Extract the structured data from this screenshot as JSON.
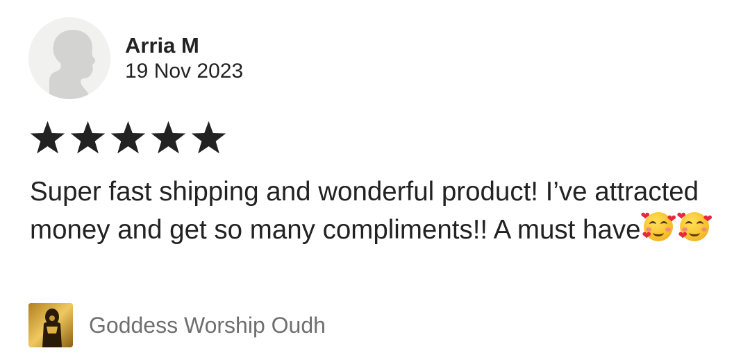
{
  "review": {
    "author": "Arria M",
    "date": "19 Nov 2023",
    "rating": 5,
    "rating_max": 5,
    "text": "Super fast shipping and wonderful product! I’ve attracted money and get so many compliments!! A must have",
    "emojis": [
      "smiling-face-with-hearts",
      "smiling-face-with-hearts"
    ],
    "star_color": "#222222"
  },
  "item": {
    "name": "Goddess Worship Oudh",
    "thumbnail_icon": "product-thumbnail"
  },
  "colors": {
    "text": "#222222",
    "muted": "#6f6f6f",
    "avatar_bg": "#f1f1ef",
    "avatar_silhouette": "#d3d3d1"
  }
}
